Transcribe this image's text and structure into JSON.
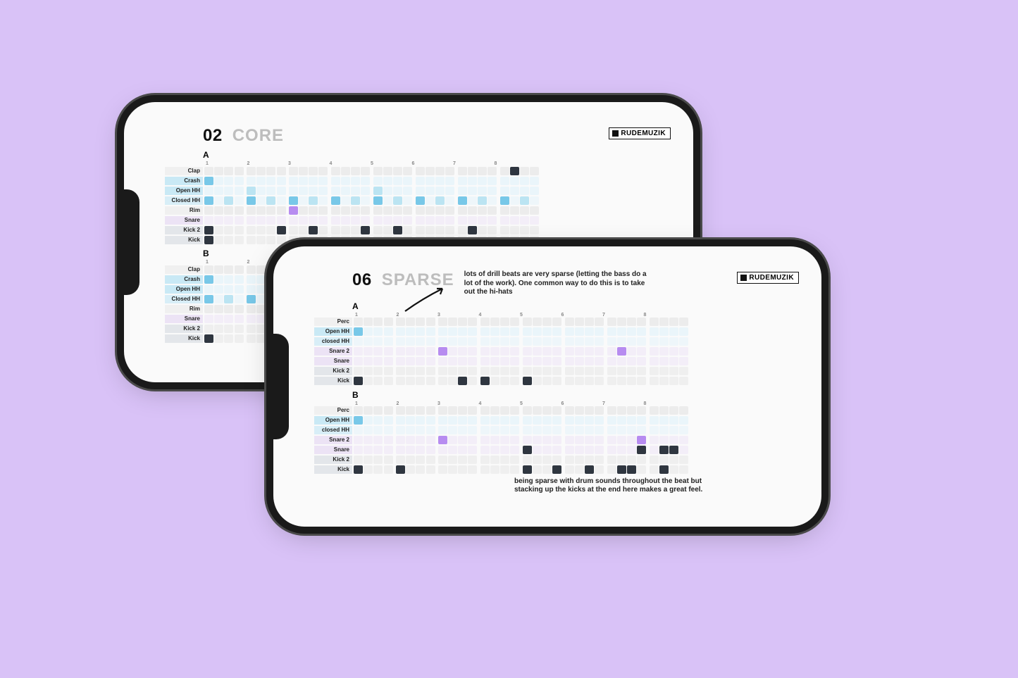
{
  "brand": "RUDEMUZIK",
  "cell_colors": {
    "blue": "#78c8e8",
    "blue_dim": "#bbe4f2",
    "lightblue": "#d9f0f8",
    "purple": "#b78cf0",
    "purple_dim": "#e3d3f7",
    "dark": "#2f3640",
    "empty": "#ececec",
    "empty_light": "#f3f3f3"
  },
  "row_stripes": {
    "crash_openhh": "#c9e9f5",
    "closedhh": "#d8eef7",
    "snare": "#ece3f5",
    "kick": "#e3e6ea"
  },
  "phones": [
    {
      "id": "back",
      "title_num": "02",
      "title_word": "CORE",
      "description": "",
      "footnote": "",
      "patterns": [
        {
          "label": "A",
          "rows": [
            {
              "name": "Clap",
              "stripe": "",
              "cells": "................................",
              "accent": {
                "29": "dark"
              }
            },
            {
              "name": "Crash",
              "stripe": "crash_openhh",
              "cells": "B...............................",
              "accent": {}
            },
            {
              "name": "Open HH",
              "stripe": "crash_openhh",
              "cells": "....b...........b...............",
              "accent": {}
            },
            {
              "name": "Closed HH",
              "stripe": "closedhh",
              "cells": "B.b.B.b.B.b.B.b.B.b.B.b.B.b.B.b.",
              "accent": {}
            },
            {
              "name": "Rim",
              "stripe": "",
              "cells": "........P.......................",
              "accent": {}
            },
            {
              "name": "Snare",
              "stripe": "snare",
              "cells": "................................",
              "accent": {}
            },
            {
              "name": "Kick 2",
              "stripe": "kick",
              "cells": "D......D..D....D..D......D......",
              "accent": {}
            },
            {
              "name": "Kick",
              "stripe": "kick",
              "cells": "D...............................",
              "accent": {}
            }
          ]
        },
        {
          "label": "B",
          "rows": [
            {
              "name": "Clap",
              "stripe": "",
              "cells": "................................",
              "accent": {}
            },
            {
              "name": "Crash",
              "stripe": "crash_openhh",
              "cells": "B...............................",
              "accent": {}
            },
            {
              "name": "Open HH",
              "stripe": "crash_openhh",
              "cells": "................................",
              "accent": {}
            },
            {
              "name": "Closed HH",
              "stripe": "closedhh",
              "cells": "B.b.B.b.B.b.B.b.B.b.B.b.B.b.B.b.",
              "accent": {}
            },
            {
              "name": "Rim",
              "stripe": "",
              "cells": "................................",
              "accent": {}
            },
            {
              "name": "Snare",
              "stripe": "snare",
              "cells": "................................",
              "accent": {}
            },
            {
              "name": "Kick 2",
              "stripe": "kick",
              "cells": "................................",
              "accent": {}
            },
            {
              "name": "Kick",
              "stripe": "kick",
              "cells": "D...............................",
              "accent": {}
            }
          ]
        }
      ]
    },
    {
      "id": "front",
      "title_num": "06",
      "title_word": "SPARSE",
      "description": "lots of  drill beats are very sparse (letting the bass do a lot of the work). One common way to do this is to take out the hi-hats",
      "footnote": "being sparse with drum sounds throughout the beat but stacking up the kicks at the end here makes a great feel.",
      "show_arrow": true,
      "patterns": [
        {
          "label": "A",
          "rows": [
            {
              "name": "Perc",
              "stripe": "",
              "cells": "................................",
              "accent": {}
            },
            {
              "name": "Open HH",
              "stripe": "crash_openhh",
              "cells": "B...............................",
              "accent": {}
            },
            {
              "name": "closed HH",
              "stripe": "closedhh",
              "cells": "................................",
              "accent": {}
            },
            {
              "name": "Snare 2",
              "stripe": "snare",
              "cells": "........P................P......",
              "accent": {}
            },
            {
              "name": "Snare",
              "stripe": "snare",
              "cells": "................................",
              "accent": {}
            },
            {
              "name": "Kick 2",
              "stripe": "kick",
              "cells": "................................",
              "accent": {}
            },
            {
              "name": "Kick",
              "stripe": "kick",
              "cells": "D.........D.D...D...............",
              "accent": {}
            }
          ]
        },
        {
          "label": "B",
          "rows": [
            {
              "name": "Perc",
              "stripe": "",
              "cells": "................................",
              "accent": {}
            },
            {
              "name": "Open HH",
              "stripe": "crash_openhh",
              "cells": "B...............................",
              "accent": {}
            },
            {
              "name": "closed HH",
              "stripe": "closedhh",
              "cells": "................................",
              "accent": {}
            },
            {
              "name": "Snare 2",
              "stripe": "snare",
              "cells": "........P..................P....",
              "accent": {}
            },
            {
              "name": "Snare",
              "stripe": "snare",
              "cells": "................D..........D.DD.",
              "accent": {}
            },
            {
              "name": "Kick 2",
              "stripe": "kick",
              "cells": "................................",
              "accent": {}
            },
            {
              "name": "Kick",
              "stripe": "kick",
              "cells": "D...D...........D..D..D..DD..D..",
              "accent": {}
            }
          ]
        }
      ]
    }
  ],
  "beat_numbers": [
    "1",
    "2",
    "3",
    "4",
    "5",
    "6",
    "7",
    "8"
  ]
}
